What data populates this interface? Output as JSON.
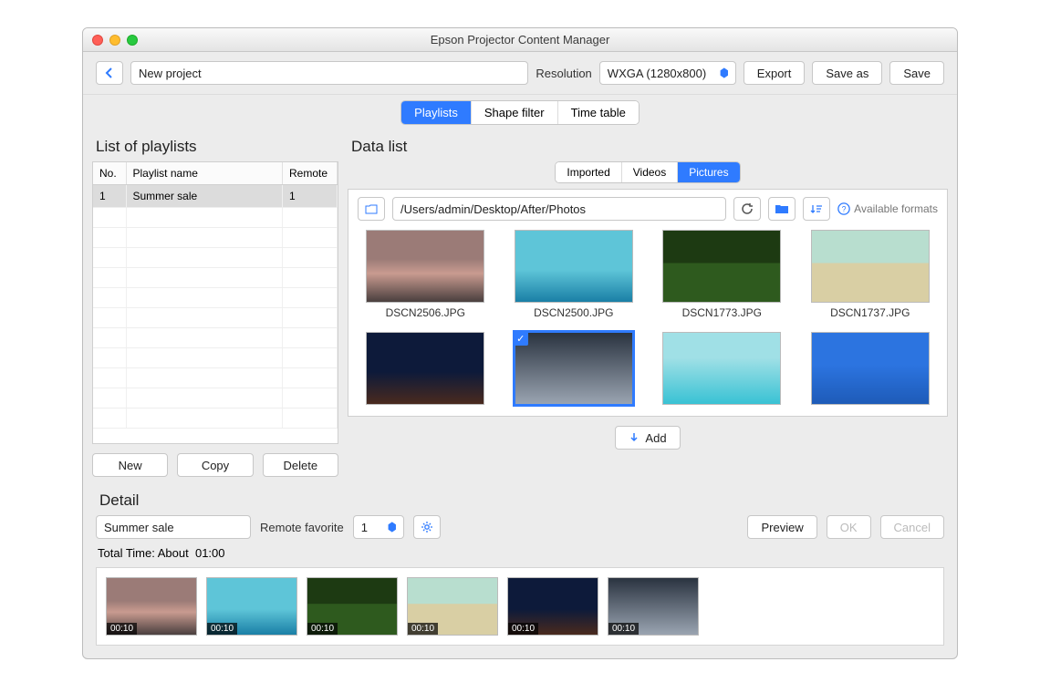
{
  "window": {
    "title": "Epson Projector Content Manager"
  },
  "toolbar": {
    "project_name": "New project",
    "resolution_label": "Resolution",
    "resolution_value": "WXGA (1280x800)",
    "export": "Export",
    "save_as": "Save as",
    "save": "Save"
  },
  "main_tabs": {
    "playlists": "Playlists",
    "shape_filter": "Shape filter",
    "time_table": "Time table",
    "active": "playlists"
  },
  "playlists_panel": {
    "title": "List of playlists",
    "columns": {
      "no": "No.",
      "name": "Playlist name",
      "remote": "Remote"
    },
    "rows": [
      {
        "no": "1",
        "name": "Summer sale",
        "remote": "1"
      }
    ],
    "buttons": {
      "new": "New",
      "copy": "Copy",
      "delete": "Delete"
    }
  },
  "data_list": {
    "title": "Data list",
    "tabs": {
      "imported": "Imported",
      "videos": "Videos",
      "pictures": "Pictures",
      "active": "pictures"
    },
    "path": "/Users/admin/Desktop/After/Photos",
    "available_formats": "Available formats",
    "items": [
      {
        "name": "DSCN2506.JPG",
        "style": "sunset"
      },
      {
        "name": "DSCN2500.JPG",
        "style": "sea"
      },
      {
        "name": "DSCN1773.JPG",
        "style": "grass"
      },
      {
        "name": "DSCN1737.JPG",
        "style": "sand"
      },
      {
        "name": "",
        "style": "palm"
      },
      {
        "name": "",
        "style": "clouds",
        "selected": true
      },
      {
        "name": "",
        "style": "teal"
      },
      {
        "name": "",
        "style": "bluesea"
      }
    ],
    "add_label": "Add"
  },
  "detail": {
    "title": "Detail",
    "name": "Summer sale",
    "remote_favorite_label": "Remote favorite",
    "remote_favorite_value": "1",
    "preview": "Preview",
    "ok": "OK",
    "cancel": "Cancel",
    "total_time_label": "Total Time: About",
    "total_time_value": "01:00",
    "timeline": [
      {
        "style": "sunset",
        "dur": "00:10"
      },
      {
        "style": "sea",
        "dur": "00:10"
      },
      {
        "style": "grass",
        "dur": "00:10"
      },
      {
        "style": "sand",
        "dur": "00:10"
      },
      {
        "style": "palm",
        "dur": "00:10"
      },
      {
        "style": "clouds",
        "dur": "00:10"
      }
    ]
  }
}
